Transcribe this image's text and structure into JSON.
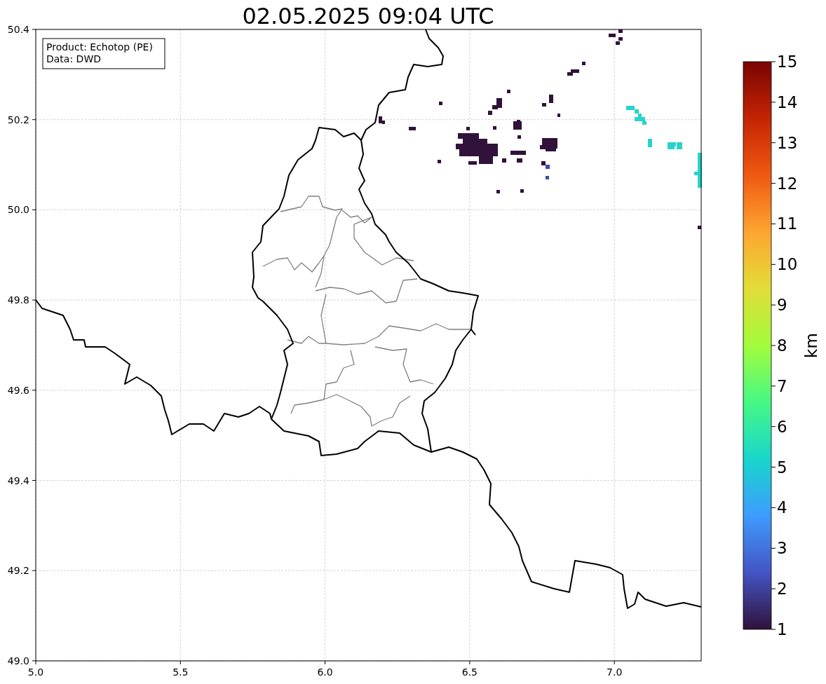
{
  "title": "02.05.2025 09:04 UTC",
  "annotation": [
    "Product: Echotop (PE)",
    "Data: DWD"
  ],
  "x_ticks": [
    "5.0",
    "5.5",
    "6.0",
    "6.5",
    "7.0"
  ],
  "y_ticks": [
    "50.4",
    "50.2",
    "50.0",
    "49.8",
    "49.6",
    "49.4",
    "49.2",
    "49.0"
  ],
  "colorbar": {
    "label": "km",
    "ticks": [
      "15",
      "14",
      "13",
      "12",
      "11",
      "10",
      "9",
      "8",
      "7",
      "6",
      "5",
      "4",
      "3",
      "2",
      "1"
    ]
  }
}
